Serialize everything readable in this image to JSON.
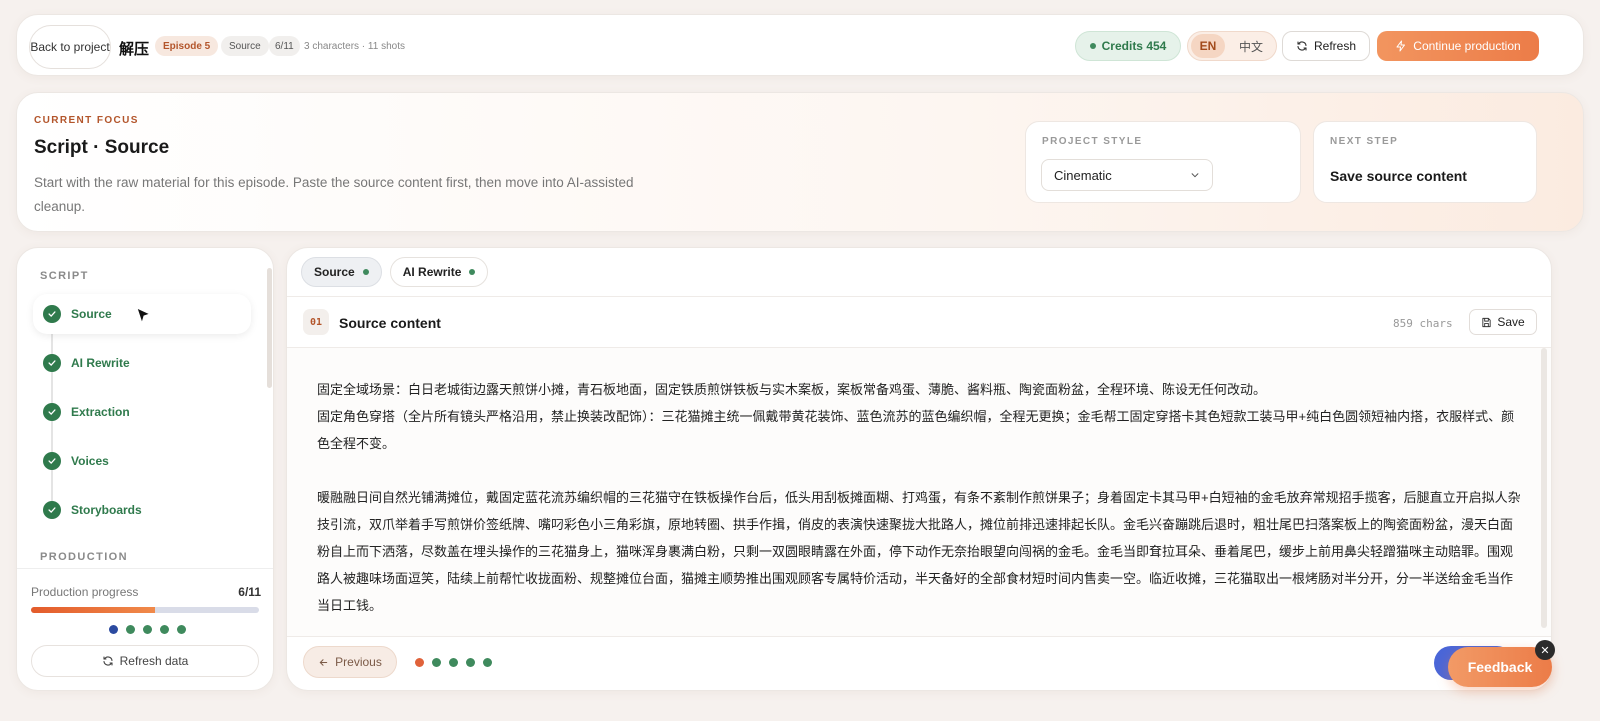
{
  "topbar": {
    "back_label": "Back to project",
    "project_title": "解压",
    "episode": "Episode 5",
    "stage": "Source",
    "step_count": "6/11",
    "meta": "3 characters · 11 shots",
    "credits": "Credits 454",
    "lang_en": "EN",
    "lang_zh": "中文",
    "refresh": "Refresh",
    "continue": "Continue production"
  },
  "focus": {
    "eyebrow": "CURRENT FOCUS",
    "title": "Script · Source",
    "description": "Start with the raw material for this episode. Paste the source content first, then move into AI-assisted cleanup.",
    "style_label": "PROJECT STYLE",
    "style_value": "Cinematic",
    "next_label": "NEXT STEP",
    "next_value": "Save source content"
  },
  "sidebar": {
    "script_label": "SCRIPT",
    "production_label": "PRODUCTION",
    "steps": [
      {
        "label": "Source"
      },
      {
        "label": "AI Rewrite"
      },
      {
        "label": "Extraction"
      },
      {
        "label": "Voices"
      },
      {
        "label": "Storyboards"
      }
    ],
    "progress_label": "Production progress",
    "progress_value": "6/11",
    "progress_fraction": 0.545,
    "refresh_data": "Refresh data"
  },
  "main": {
    "tabs": [
      {
        "label": "Source"
      },
      {
        "label": "AI Rewrite"
      }
    ],
    "section_number": "01",
    "section_title": "Source content",
    "chars": "859 chars",
    "save": "Save",
    "content": "固定全域场景：白日老城街边露天煎饼小摊，青石板地面，固定铁质煎饼铁板与实木案板，案板常备鸡蛋、薄脆、酱料瓶、陶瓷面粉盆，全程环境、陈设无任何改动。\n固定角色穿搭（全片所有镜头严格沿用，禁止换装改配饰）：三花猫摊主统一佩戴带黄花装饰、蓝色流苏的蓝色编织帽，全程无更换；金毛帮工固定穿搭卡其色短款工装马甲+纯白色圆领短袖内搭，衣服样式、颜色全程不变。\n\n暖融融日间自然光铺满摊位，戴固定蓝花流苏编织帽的三花猫守在铁板操作台后，低头用刮板摊面糊、打鸡蛋，有条不紊制作煎饼果子；身着固定卡其马甲+白短袖的金毛放弃常规招手揽客，后腿直立开启拟人杂技引流，双爪举着手写煎饼价签纸牌、嘴叼彩色小三角彩旗，原地转圈、拱手作揖，俏皮的表演快速聚拢大批路人，摊位前排迅速排起长队。金毛兴奋蹦跳后退时，粗壮尾巴扫落案板上的陶瓷面粉盆，漫天白面粉自上而下洒落，尽数盖在埋头操作的三花猫身上，猫咪浑身裹满白粉，只剩一双圆眼睛露在外面，停下动作无奈抬眼望向闯祸的金毛。金毛当即耷拉耳朵、垂着尾巴，缓步上前用鼻尖轻蹭猫咪主动赔罪。围观路人被趣味场面逗笑，陆续上前帮忙收拢面粉、规整摊位台面，猫摊主顺势推出围观顾客专属特价活动，半天备好的全部食材短时间内售卖一空。临近收摊，三花猫取出一根烤肠对半分开，分一半送给金毛当作当日工钱。",
    "prev": "Previous"
  },
  "feedback": "Feedback",
  "colors": {
    "accent": "#ec7c48",
    "success": "#2f7a4c",
    "brand_text": "#b3552b"
  }
}
